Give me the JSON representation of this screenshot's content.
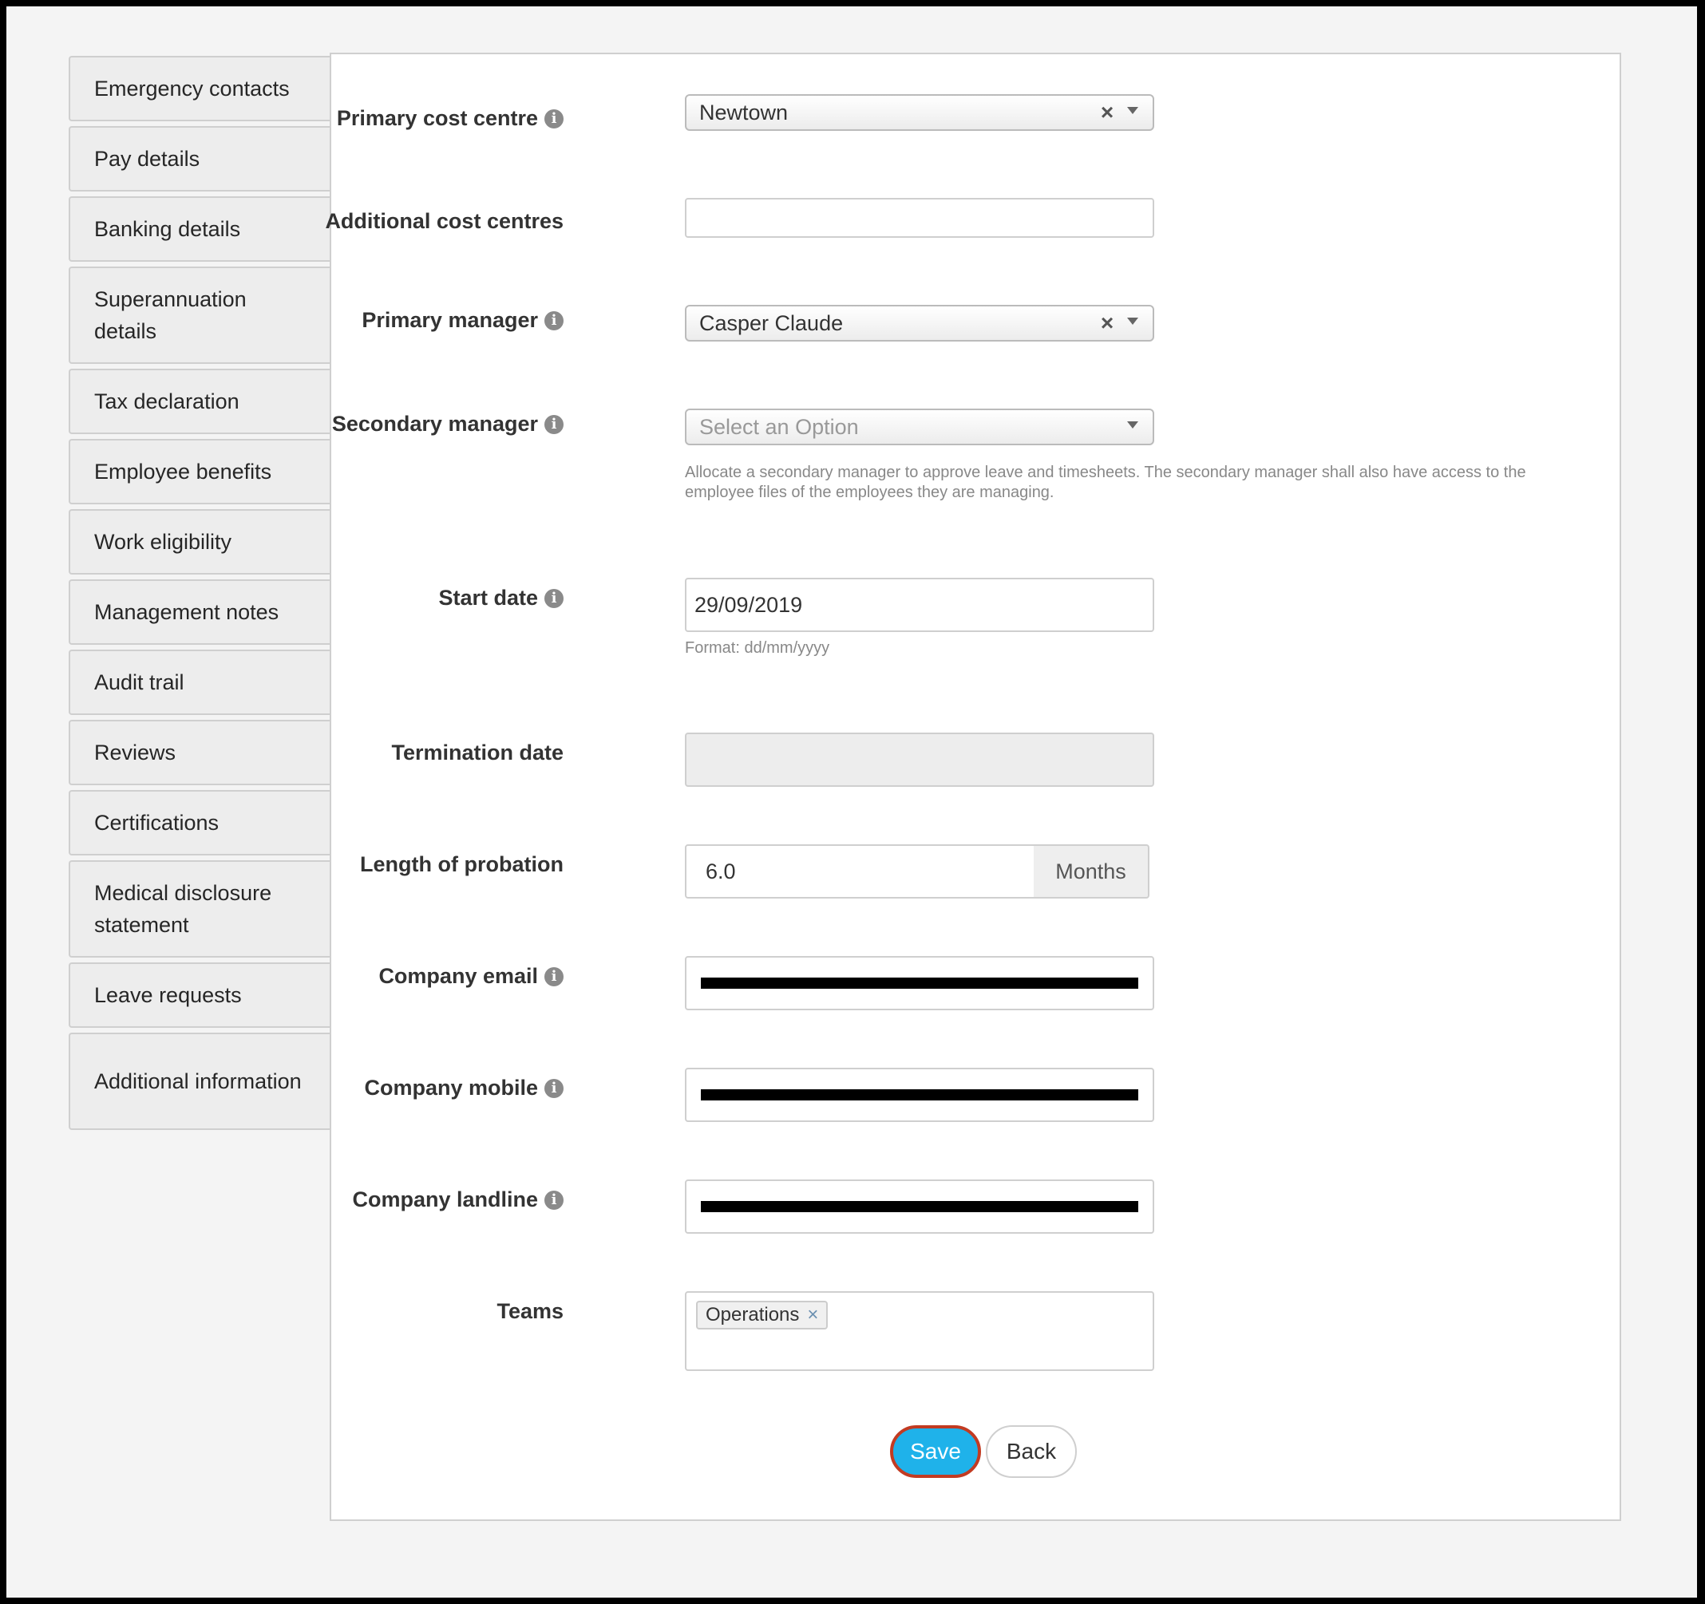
{
  "sidebar": {
    "items": [
      {
        "label": "Emergency contacts"
      },
      {
        "label": "Pay details"
      },
      {
        "label": "Banking details"
      },
      {
        "label": "Superannuation details"
      },
      {
        "label": "Tax declaration"
      },
      {
        "label": "Employee benefits"
      },
      {
        "label": "Work eligibility"
      },
      {
        "label": "Management notes"
      },
      {
        "label": "Audit trail"
      },
      {
        "label": "Reviews"
      },
      {
        "label": "Certifications"
      },
      {
        "label": "Medical disclosure statement"
      },
      {
        "label": "Leave requests"
      },
      {
        "label": "Additional information"
      }
    ]
  },
  "form": {
    "primary_cost_centre": {
      "label": "Primary cost centre",
      "value": "Newtown"
    },
    "additional_cost_centres": {
      "label": "Additional cost centres",
      "value": ""
    },
    "primary_manager": {
      "label": "Primary manager",
      "value": "Casper Claude"
    },
    "secondary_manager": {
      "label": "Secondary manager",
      "placeholder": "Select an Option",
      "help": "Allocate a secondary manager to approve leave and timesheets. The secondary manager shall also have access to the employee files of the employees they are managing."
    },
    "start_date": {
      "label": "Start date",
      "value": "29/09/2019",
      "help": "Format: dd/mm/yyyy"
    },
    "termination_date": {
      "label": "Termination date",
      "value": ""
    },
    "length_of_probation": {
      "label": "Length of probation",
      "value": "6.0",
      "unit": "Months"
    },
    "company_email": {
      "label": "Company email",
      "value": "[redacted]"
    },
    "company_mobile": {
      "label": "Company mobile",
      "value": "[redacted]"
    },
    "company_landline": {
      "label": "Company landline",
      "value": "[redacted]"
    },
    "teams": {
      "label": "Teams",
      "chips": [
        "Operations"
      ]
    }
  },
  "actions": {
    "save_label": "Save",
    "back_label": "Back"
  },
  "colors": {
    "accent": "#1fb2ea",
    "focus_ring": "#c23b22"
  },
  "icons": {
    "info": "info-icon",
    "clear": "clear-icon",
    "caret": "chevron-down-icon",
    "chip_remove": "close-icon"
  }
}
